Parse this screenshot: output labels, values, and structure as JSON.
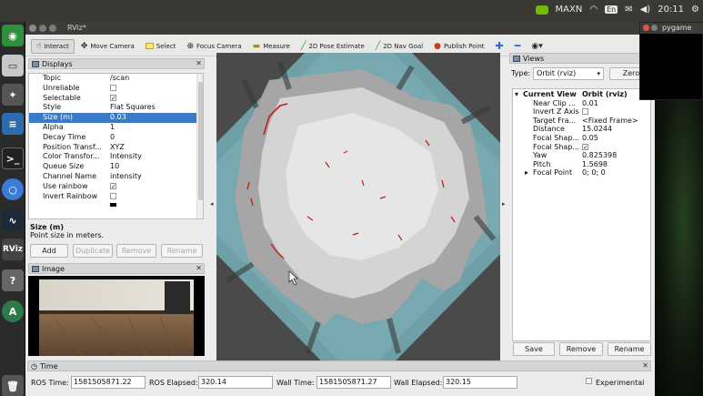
{
  "topbar": {
    "status": "MAXN",
    "kbd": "En",
    "time": "20:11"
  },
  "window": {
    "title": "RViz*"
  },
  "toolbar": {
    "interact": "Interact",
    "move_camera": "Move Camera",
    "select": "Select",
    "focus_camera": "Focus Camera",
    "measure": "Measure",
    "pose_estimate": "2D Pose Estimate",
    "nav_goal": "2D Nav Goal",
    "publish_point": "Publish Point"
  },
  "displays": {
    "title": "Displays",
    "rows": [
      {
        "key": "Topic",
        "value": "/scan"
      },
      {
        "key": "Unreliable",
        "value": ""
      },
      {
        "key": "Selectable",
        "value": "✓"
      },
      {
        "key": "Style",
        "value": "Flat Squares"
      },
      {
        "key": "Size (m)",
        "value": "0.03"
      },
      {
        "key": "Alpha",
        "value": "1"
      },
      {
        "key": "Decay Time",
        "value": "0"
      },
      {
        "key": "Position Transf...",
        "value": "XYZ"
      },
      {
        "key": "Color Transfor...",
        "value": "Intensity"
      },
      {
        "key": "Queue Size",
        "value": "10"
      },
      {
        "key": "Channel Name",
        "value": "intensity"
      },
      {
        "key": "Use rainbow",
        "value": "✓"
      },
      {
        "key": "Invert Rainbow",
        "value": ""
      }
    ],
    "desc_title": "Size (m)",
    "desc_text": "Point size in meters.",
    "buttons": {
      "add": "Add",
      "duplicate": "Duplicate",
      "remove": "Remove",
      "rename": "Rename"
    }
  },
  "image_panel": {
    "title": "Image"
  },
  "views": {
    "title": "Views",
    "type_label": "Type:",
    "type_value": "Orbit (rviz)",
    "zero": "Zero",
    "current_view": {
      "key": "Current View",
      "value": "Orbit (rviz)"
    },
    "rows": [
      {
        "key": "Near Clip ...",
        "value": "0.01"
      },
      {
        "key": "Invert Z Axis",
        "value": ""
      },
      {
        "key": "Target Fra...",
        "value": "<Fixed Frame>"
      },
      {
        "key": "Distance",
        "value": "15.0244"
      },
      {
        "key": "Focal Shap...",
        "value": "0.05"
      },
      {
        "key": "Focal Shap...",
        "value": "✓"
      },
      {
        "key": "Yaw",
        "value": "0.825398"
      },
      {
        "key": "Pitch",
        "value": "1.5698"
      },
      {
        "key": "Focal Point",
        "value": "0; 0; 0"
      }
    ],
    "buttons": {
      "save": "Save",
      "remove": "Remove",
      "rename": "Rename"
    }
  },
  "time": {
    "title": "Time",
    "ros_time_label": "ROS Time:",
    "ros_time": "1581505871.22",
    "ros_elapsed_label": "ROS Elapsed:",
    "ros_elapsed": "320.14",
    "wall_time_label": "Wall Time:",
    "wall_time": "1581505871.27",
    "wall_elapsed_label": "Wall Elapsed:",
    "wall_elapsed": "320.15",
    "experimental": "Experimental"
  },
  "pygame": {
    "title": "pygame"
  },
  "launcher": {
    "rviz_label": "RViz"
  }
}
